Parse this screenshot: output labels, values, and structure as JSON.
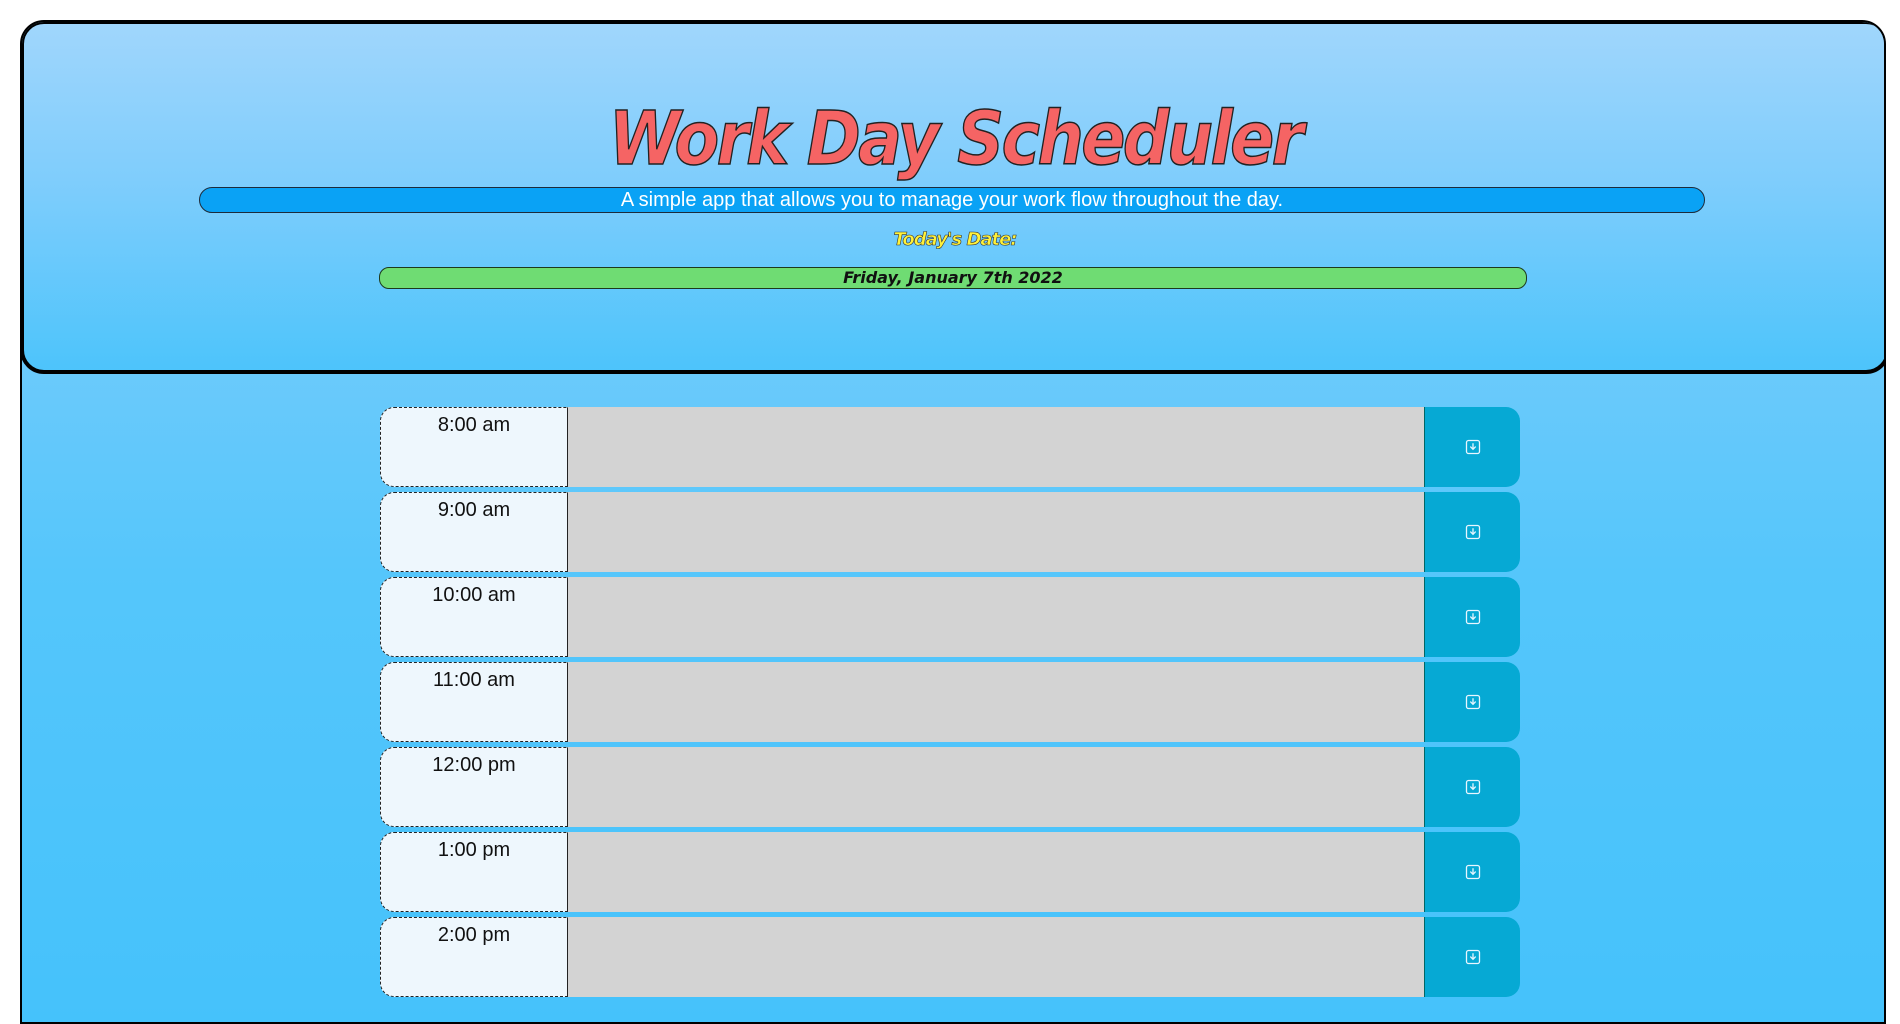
{
  "header": {
    "title": "Work Day Scheduler",
    "lead": "A simple app that allows you to manage your work flow throughout the day.",
    "today_label": "Today's Date:",
    "today_value": "Friday, January 7th 2022"
  },
  "schedule": {
    "rows": [
      {
        "hour": "8:00 am",
        "text": ""
      },
      {
        "hour": "9:00 am",
        "text": ""
      },
      {
        "hour": "10:00 am",
        "text": ""
      },
      {
        "hour": "11:00 am",
        "text": ""
      },
      {
        "hour": "12:00 pm",
        "text": ""
      },
      {
        "hour": "1:00 pm",
        "text": ""
      },
      {
        "hour": "2:00 pm",
        "text": ""
      }
    ],
    "save_icon": "save-download-icon"
  },
  "colors": {
    "title": "#f56464",
    "lead_bar": "#0aa2f5",
    "date_bar": "#6fdc73",
    "today_label": "#fff23a",
    "hour_cell": "#eef7fd",
    "textarea": "#d3d3d3",
    "save_button": "#06a9d4"
  }
}
